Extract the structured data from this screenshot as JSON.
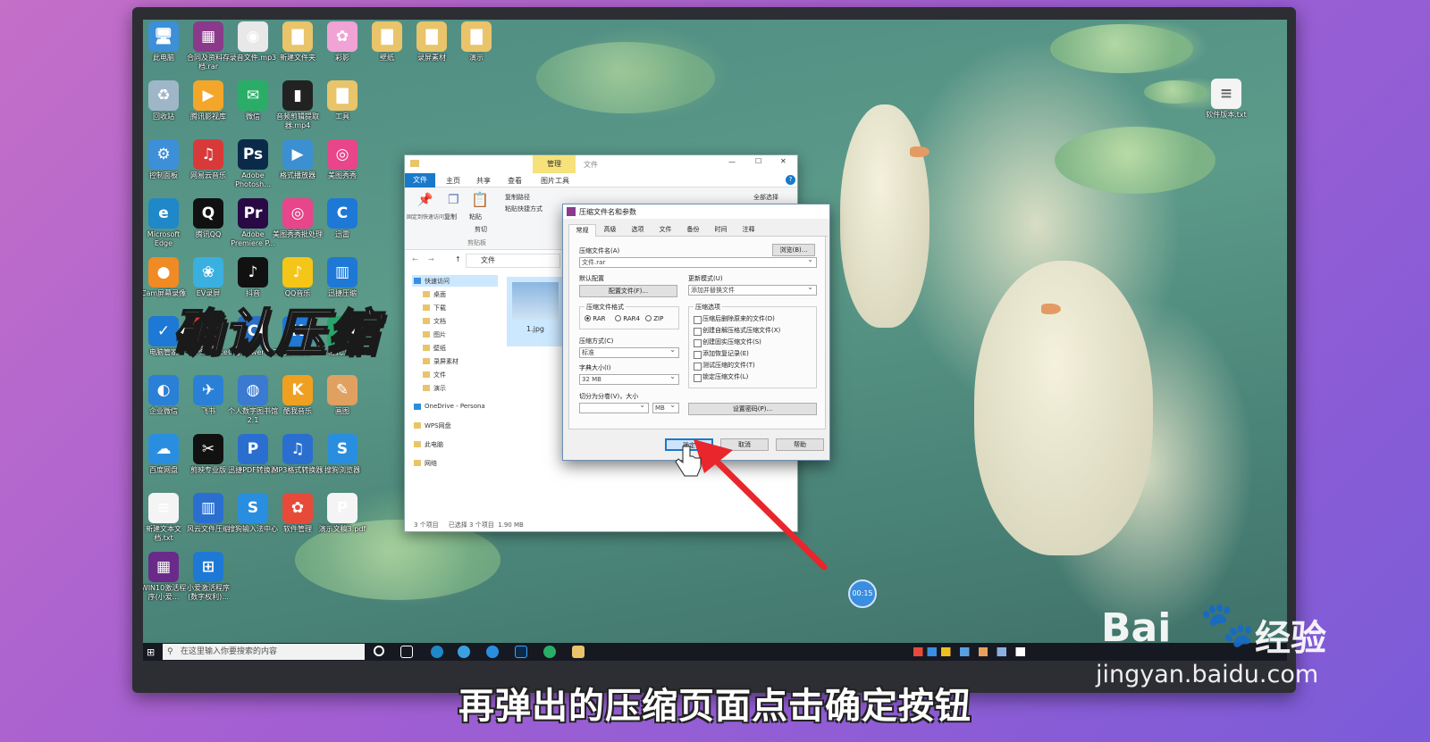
{
  "overlay_title": "确认压缩",
  "subtitle": "再弹出的压缩页面点击确定按钮",
  "watermark": {
    "brand": "Bai",
    "brand_cn": "经验",
    "url": "jingyan.baidu.com"
  },
  "timer": "00:15",
  "desktop_icons": [
    {
      "label": "此电脑",
      "color": "#3d8fd8",
      "glyph": "🖥"
    },
    {
      "label": "合同及资料存档.rar",
      "color": "#8b3a8b",
      "glyph": "▦"
    },
    {
      "label": "录音文件.mp3",
      "color": "#e8e8e8",
      "glyph": "◉"
    },
    {
      "label": "新建文件夹",
      "color": "#e9c46a",
      "glyph": "▇"
    },
    {
      "label": "彩影",
      "color": "#f0a3d4",
      "glyph": "✿"
    },
    {
      "label": "壁纸",
      "color": "#e9c46a",
      "glyph": "▇"
    },
    {
      "label": "录屏素材",
      "color": "#e9c46a",
      "glyph": "▇"
    },
    {
      "label": "演示",
      "color": "#e9c46a",
      "glyph": "▇"
    },
    {
      "label": "回收站",
      "color": "#9fb6c8",
      "glyph": "♻"
    },
    {
      "label": "腾讯影视库",
      "color": "#f4a62a",
      "glyph": "▶"
    },
    {
      "label": "微信",
      "color": "#2aae67",
      "glyph": "✉"
    },
    {
      "label": "音频剪辑提取器.mp4",
      "color": "#222",
      "glyph": "▮"
    },
    {
      "label": "工具",
      "color": "#e9c46a",
      "glyph": "▇"
    },
    {
      "label": "控制面板",
      "color": "#3d8fd8",
      "glyph": "⚙"
    },
    {
      "label": "网易云音乐",
      "color": "#d83a3a",
      "glyph": "♫"
    },
    {
      "label": "Adobe Photosh...",
      "color": "#0b2a4a",
      "glyph": "Ps"
    },
    {
      "label": "格式播放器",
      "color": "#3c8fd0",
      "glyph": "▶"
    },
    {
      "label": "美图秀秀",
      "color": "#e8458a",
      "glyph": "◎"
    },
    {
      "label": "Microsoft Edge",
      "color": "#1e88c8",
      "glyph": "e"
    },
    {
      "label": "腾讯QQ",
      "color": "#111",
      "glyph": "Q"
    },
    {
      "label": "Adobe Premiere P...",
      "color": "#2a0a45",
      "glyph": "Pr"
    },
    {
      "label": "美图秀秀批处理",
      "color": "#e8458a",
      "glyph": "◎"
    },
    {
      "label": "迅雷",
      "color": "#1d78d6",
      "glyph": "C"
    },
    {
      "label": "Cam屏幕录像",
      "color": "#f08a24",
      "glyph": "●"
    },
    {
      "label": "EV录屏",
      "color": "#3ab0e0",
      "glyph": "❀"
    },
    {
      "label": "抖音",
      "color": "#111",
      "glyph": "♪"
    },
    {
      "label": "QQ音乐",
      "color": "#f5c518",
      "glyph": "♪"
    },
    {
      "label": "迅捷压缩",
      "color": "#1d78d6",
      "glyph": "▥"
    },
    {
      "label": "电脑管家",
      "color": "#1d78d6",
      "glyph": "✓"
    },
    {
      "label": "WPS Office",
      "color": "#d8392c",
      "glyph": "W"
    },
    {
      "label": "CAJViewer 7.3",
      "color": "#2a6fc4",
      "glyph": "C"
    },
    {
      "label": "酷狗音乐",
      "color": "#1d78d6",
      "glyph": "K"
    },
    {
      "label": "格式工厂",
      "color": "#2aa36a",
      "glyph": "F"
    },
    {
      "label": "企业微信",
      "color": "#2a80d6",
      "glyph": "◐"
    },
    {
      "label": "飞书",
      "color": "#2a80d6",
      "glyph": "✈"
    },
    {
      "label": "个人数字图书馆2.1",
      "color": "#3a7ad0",
      "glyph": "◍"
    },
    {
      "label": "酷我音乐",
      "color": "#f0a020",
      "glyph": "K"
    },
    {
      "label": "画图",
      "color": "#e0a060",
      "glyph": "✎"
    },
    {
      "label": "百度网盘",
      "color": "#2a8ee0",
      "glyph": "☁"
    },
    {
      "label": "剪映专业版",
      "color": "#111",
      "glyph": "✂"
    },
    {
      "label": "迅捷PDF转换器",
      "color": "#2a6fd0",
      "glyph": "P"
    },
    {
      "label": "MP3格式转换器",
      "color": "#2a6fd0",
      "glyph": "♫"
    },
    {
      "label": "搜狗浏览器",
      "color": "#2a8ee0",
      "glyph": "S"
    },
    {
      "label": "新建文本文档.txt",
      "color": "#f4f4f4",
      "glyph": "≡"
    },
    {
      "label": "风云文件压缩",
      "color": "#2a6fd0",
      "glyph": "▥"
    },
    {
      "label": "搜狗输入法中心",
      "color": "#2a8ee0",
      "glyph": "S"
    },
    {
      "label": "软件管理",
      "color": "#e84a3a",
      "glyph": "✿"
    },
    {
      "label": "演示文稿3.pdf",
      "color": "#f4f4f4",
      "glyph": "P"
    },
    {
      "label": "WIN10激活程序(小爱...",
      "color": "#6a2a8a",
      "glyph": "▦"
    },
    {
      "label": "小爱激活程序(数字权利)...",
      "color": "#1d78d6",
      "glyph": "⊞"
    },
    {
      "label": "软件版本.txt",
      "color": "#f4f4f4",
      "glyph": "≡"
    }
  ],
  "taskbar": {
    "search_placeholder": "在这里输入你要搜索的内容"
  },
  "explorer": {
    "tabs_top": [
      "管理",
      "文件"
    ],
    "ribbon_tabs": [
      "文件",
      "主页",
      "共享",
      "查看",
      "图片工具"
    ],
    "ribbon": {
      "pin": "固定到快速访问",
      "copy": "复制",
      "paste": "粘贴",
      "copy_path": "复制路径",
      "paste_shortcut": "粘贴快捷方式",
      "cut": "剪切",
      "clipboard": "剪贴板",
      "select_all": "全部选择"
    },
    "address": "文件",
    "nav": [
      "快速访问",
      "桌面",
      "下载",
      "文档",
      "图片",
      "壁纸",
      "录屏素材",
      "文件",
      "演示",
      "OneDrive - Persona",
      "WPS网盘",
      "此电脑",
      "网络"
    ],
    "file": "1.jpg",
    "status": "3 个项目     已选择 3 个项目  1.90 MB"
  },
  "dialog": {
    "title": "压缩文件名和参数",
    "tabs": [
      "常规",
      "高级",
      "选项",
      "文件",
      "备份",
      "时间",
      "注释"
    ],
    "archive_name_label": "压缩文件名(A)",
    "archive_name_value": "文件.rar",
    "browse": "浏览(B)...",
    "default_profile_label": "默认配置",
    "profile_button": "配置文件(F)...",
    "update_mode_label": "更新模式(U)",
    "update_mode_value": "添加并替换文件",
    "format_label": "压缩文件格式",
    "formats": [
      "RAR",
      "RAR4",
      "ZIP"
    ],
    "options_label": "压缩选项",
    "options": [
      "压缩后删除原来的文件(D)",
      "创建自解压格式压缩文件(X)",
      "创建固实压缩文件(S)",
      "添加恢复记录(E)",
      "测试压缩的文件(T)",
      "锁定压缩文件(L)"
    ],
    "method_label": "压缩方式(C)",
    "method_value": "标准",
    "dict_label": "字典大小(I)",
    "dict_value": "32 MB",
    "split_label": "切分为分卷(V)，大小",
    "split_unit": "MB",
    "password_button": "设置密码(P)...",
    "ok": "确定",
    "cancel": "取消",
    "help": "帮助"
  }
}
